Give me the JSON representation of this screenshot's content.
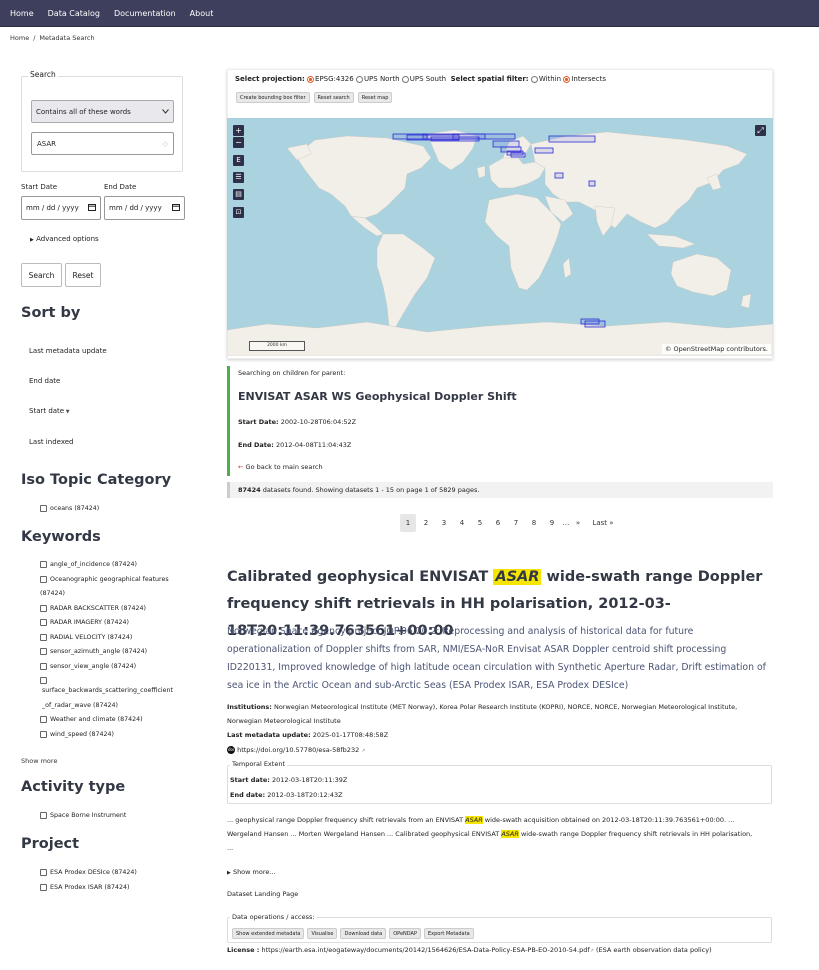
{
  "nav": {
    "items": [
      "Home",
      "Data Catalog",
      "Documentation",
      "About"
    ]
  },
  "breadcrumb": {
    "home": "Home",
    "sep": "/",
    "current": "Metadata Search"
  },
  "search": {
    "legend": "Search",
    "mode": "Contains all of these words",
    "query": "ASAR",
    "start_label": "Start Date",
    "end_label": "End Date",
    "date_placeholder": "mm / dd / yyyy",
    "advanced": "Advanced options",
    "search_btn": "Search",
    "reset_btn": "Reset"
  },
  "sort": {
    "title": "Sort by",
    "items": [
      "Last metadata update",
      "End date",
      "Start date",
      "Last indexed"
    ]
  },
  "iso": {
    "title": "Iso Topic Category",
    "items": [
      "oceans (87424)"
    ]
  },
  "keywords": {
    "title": "Keywords",
    "items": [
      "angle_of_incidence (87424)",
      "Oceanographic geographical features",
      "(87424)",
      "RADAR BACKSCATTER (87424)",
      "RADAR IMAGERY (87424)",
      "RADIAL VELOCITY (87424)",
      "sensor_azimuth_angle (87424)",
      "sensor_view_angle (87424)",
      "surface_backwards_scattering_coefficient",
      "_of_radar_wave (87424)",
      "Weather and climate (87424)",
      "wind_speed (87424)"
    ],
    "show_more": "Show more"
  },
  "activity": {
    "title": "Activity type",
    "items": [
      "Space Borne Instrument"
    ]
  },
  "project": {
    "title": "Project",
    "items": [
      "ESA Prodex DESIce (87424)",
      "ESA Prodex ISAR (87424)"
    ]
  },
  "map": {
    "projection_label": "Select projection:",
    "projections": [
      "EPSG:4326",
      "UPS North",
      "UPS South"
    ],
    "filter_label": "Select spatial filter:",
    "filters": [
      "Within",
      "Intersects"
    ],
    "buttons": [
      "Create bounding box filter",
      "Reset search",
      "Reset map"
    ],
    "scale": "2000 km",
    "attribution": "© OpenStreetMap contributors.",
    "colors": {
      "ocean": "#aad3df",
      "land": "#f2efe9",
      "box": "#2b2bd4"
    }
  },
  "parent": {
    "searching": "Searching on children for parent:",
    "title": "ENVISAT ASAR WS Geophysical Doppler Shift",
    "start_label": "Start Date:",
    "start_value": "2002-10-28T06:04:52Z",
    "end_label": "End Date:",
    "end_value": "2012-04-08T11:04:43Z",
    "back": "Go back to main search"
  },
  "found": {
    "count": "87424",
    "text": "datasets found. Showing datasets 1 - 15 on page 1 of 5829 pages."
  },
  "pagination": [
    "1",
    "2",
    "3",
    "4",
    "5",
    "6",
    "7",
    "8",
    "9",
    "...",
    "»",
    "Last »"
  ],
  "result": {
    "title_a": "Calibrated geophysical ENVISAT",
    "title_hl": "ASAR",
    "title_b": "wide-swath range Doppler frequency shift retrievals in HH polarisation, 2012-03-18T20:11:39.763561+00:00",
    "description": "Norwegian Space Agency project JOP.06.20.2: Reprocessing and analysis of historical data for future operationalization of Doppler shifts from SAR, NMI/ESA-NoR Envisat ASAR Doppler centroid shift processing ID220131, Improved knowledge of high latitude ocean circulation with Synthetic Aperture Radar, Drift estimation of sea ice in the Arctic Ocean and sub-Arctic Seas (ESA Prodex ISAR, ESA Prodex DESIce)",
    "institutions_label": "Institutions:",
    "institutions": "Norwegian Meteorological Institute (MET Norway), Korea Polar Research Institute (KOPRI), NORCE, NORCE, Norwegian Meteorological Institute, Norwegian Meteorological Institute",
    "last_update_label": "Last metadata update:",
    "last_update": "2025-01-17T08:48:58Z",
    "doi": "https://doi.org/10.57780/esa-58fb232",
    "temporal_legend": "Temporal Extent",
    "start_label": "Start date:",
    "start": "2012-03-18T20:11:39Z",
    "end_label": "End date:",
    "end": "2012-03-18T20:12:43Z",
    "snippet_1a": "... geophysical range Doppler frequency shift retrievals from an ENVISAT",
    "snippet_hl": "ASAR",
    "snippet_1b": "wide-swath acquisition obtained on 2012-03-18T20:11:39.763561+00:00. ...",
    "snippet_2a": "Wergeland Hansen ... Morten Wergeland Hansen ... Calibrated geophysical ENVISAT",
    "snippet_2b": "wide-swath range Doppler frequency shift retrievals in HH polarisation,",
    "snippet_3": "...",
    "show_more": "Show more...",
    "landing": "Dataset Landing Page",
    "ops_legend": "Data operations / access:",
    "ops": [
      "Show extended metadata",
      "Visualise",
      "Download data",
      "OPeNDAP",
      "Export Metadata"
    ],
    "license_label": "License :",
    "license_url": "https://earth.esa.int/eogateway/documents/20142/1564626/ESA-Data-Policy-ESA-PB-EO-2010-54.pdf",
    "license_note": "(ESA earth observation data policy)"
  }
}
